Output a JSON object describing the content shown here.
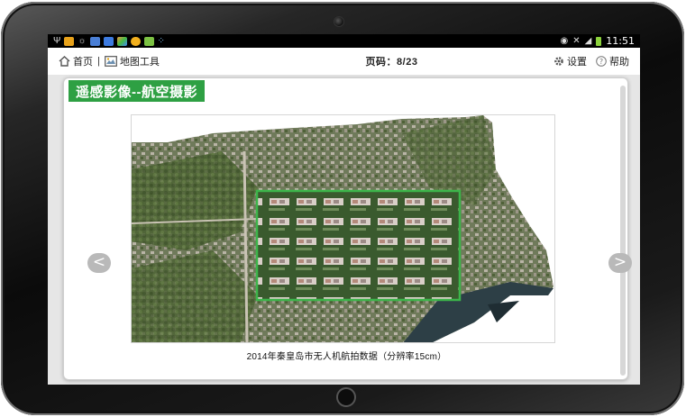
{
  "status_bar": {
    "time": "11:51",
    "icons": [
      "usb-icon",
      "app-icon-orange",
      "brightness-icon",
      "app-icon-blue",
      "app-icon-news",
      "app-icon-maps",
      "cloud-icon",
      "app-icon-green",
      "network-icon",
      "eye-icon",
      "mute-icon",
      "wifi-icon",
      "battery-charging-icon"
    ]
  },
  "toolbar": {
    "home_label": "首页",
    "separator": "|",
    "map_tools_label": "地图工具",
    "page_indicator": "页码：8/23",
    "settings_label": "设置",
    "help_label": "帮助"
  },
  "panel": {
    "title": "遥感影像--航空摄影",
    "caption": "2014年秦皇岛市无人机航拍数据（分辨率15cm）"
  },
  "navigation": {
    "prev_symbol": "<",
    "next_symbol": ">"
  },
  "colors": {
    "accent_green": "#2ea043",
    "highlight_box": "#3cb54a",
    "nav_button": "#b9b9b9"
  }
}
